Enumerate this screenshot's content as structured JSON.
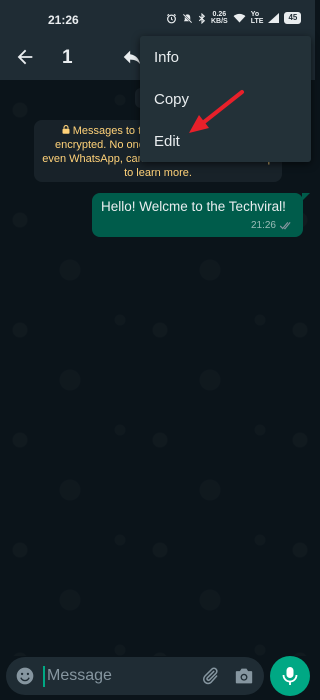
{
  "status_bar": {
    "time": "21:26",
    "net_speed_value": "0.26",
    "net_speed_unit": "KB/S",
    "network_type_top": "Yo",
    "network_type_bottom": "LTE",
    "battery": "45"
  },
  "app_bar": {
    "selected_count": "1"
  },
  "chat": {
    "encryption_notice": "Messages to this chat are end-to-end encrypted. No one outside of this chat, not even WhatsApp, can read or listen to them. Tap to learn more.",
    "message": {
      "text": "Hello! Welcme to the Techviral!",
      "time": "21:26"
    }
  },
  "overflow_menu": {
    "items": [
      "Info",
      "Copy",
      "Edit"
    ]
  },
  "annotation": {
    "arrow_color": "#e8202a"
  },
  "input_bar": {
    "placeholder": "Message"
  },
  "colors": {
    "header_bg": "#1f2c34",
    "chat_bg": "#0b141a",
    "outgoing_bubble": "#005c4b",
    "accent": "#00a884",
    "menu_bg": "#233138",
    "notice_text": "#ffd279"
  }
}
